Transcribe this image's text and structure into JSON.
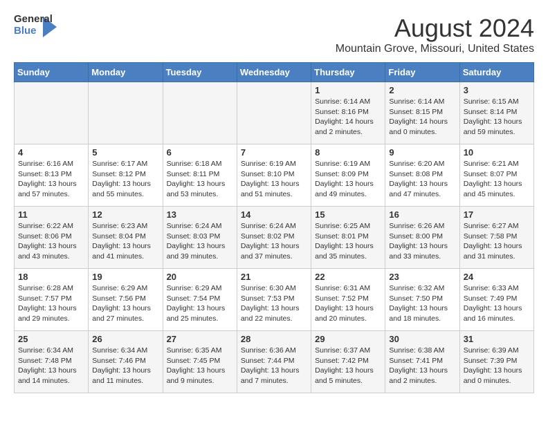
{
  "header": {
    "logo_general": "General",
    "logo_blue": "Blue",
    "main_title": "August 2024",
    "sub_title": "Mountain Grove, Missouri, United States"
  },
  "calendar": {
    "days_of_week": [
      "Sunday",
      "Monday",
      "Tuesday",
      "Wednesday",
      "Thursday",
      "Friday",
      "Saturday"
    ],
    "weeks": [
      [
        {
          "day": "",
          "info": ""
        },
        {
          "day": "",
          "info": ""
        },
        {
          "day": "",
          "info": ""
        },
        {
          "day": "",
          "info": ""
        },
        {
          "day": "1",
          "info": "Sunrise: 6:14 AM\nSunset: 8:16 PM\nDaylight: 14 hours\nand 2 minutes."
        },
        {
          "day": "2",
          "info": "Sunrise: 6:14 AM\nSunset: 8:15 PM\nDaylight: 14 hours\nand 0 minutes."
        },
        {
          "day": "3",
          "info": "Sunrise: 6:15 AM\nSunset: 8:14 PM\nDaylight: 13 hours\nand 59 minutes."
        }
      ],
      [
        {
          "day": "4",
          "info": "Sunrise: 6:16 AM\nSunset: 8:13 PM\nDaylight: 13 hours\nand 57 minutes."
        },
        {
          "day": "5",
          "info": "Sunrise: 6:17 AM\nSunset: 8:12 PM\nDaylight: 13 hours\nand 55 minutes."
        },
        {
          "day": "6",
          "info": "Sunrise: 6:18 AM\nSunset: 8:11 PM\nDaylight: 13 hours\nand 53 minutes."
        },
        {
          "day": "7",
          "info": "Sunrise: 6:19 AM\nSunset: 8:10 PM\nDaylight: 13 hours\nand 51 minutes."
        },
        {
          "day": "8",
          "info": "Sunrise: 6:19 AM\nSunset: 8:09 PM\nDaylight: 13 hours\nand 49 minutes."
        },
        {
          "day": "9",
          "info": "Sunrise: 6:20 AM\nSunset: 8:08 PM\nDaylight: 13 hours\nand 47 minutes."
        },
        {
          "day": "10",
          "info": "Sunrise: 6:21 AM\nSunset: 8:07 PM\nDaylight: 13 hours\nand 45 minutes."
        }
      ],
      [
        {
          "day": "11",
          "info": "Sunrise: 6:22 AM\nSunset: 8:06 PM\nDaylight: 13 hours\nand 43 minutes."
        },
        {
          "day": "12",
          "info": "Sunrise: 6:23 AM\nSunset: 8:04 PM\nDaylight: 13 hours\nand 41 minutes."
        },
        {
          "day": "13",
          "info": "Sunrise: 6:24 AM\nSunset: 8:03 PM\nDaylight: 13 hours\nand 39 minutes."
        },
        {
          "day": "14",
          "info": "Sunrise: 6:24 AM\nSunset: 8:02 PM\nDaylight: 13 hours\nand 37 minutes."
        },
        {
          "day": "15",
          "info": "Sunrise: 6:25 AM\nSunset: 8:01 PM\nDaylight: 13 hours\nand 35 minutes."
        },
        {
          "day": "16",
          "info": "Sunrise: 6:26 AM\nSunset: 8:00 PM\nDaylight: 13 hours\nand 33 minutes."
        },
        {
          "day": "17",
          "info": "Sunrise: 6:27 AM\nSunset: 7:58 PM\nDaylight: 13 hours\nand 31 minutes."
        }
      ],
      [
        {
          "day": "18",
          "info": "Sunrise: 6:28 AM\nSunset: 7:57 PM\nDaylight: 13 hours\nand 29 minutes."
        },
        {
          "day": "19",
          "info": "Sunrise: 6:29 AM\nSunset: 7:56 PM\nDaylight: 13 hours\nand 27 minutes."
        },
        {
          "day": "20",
          "info": "Sunrise: 6:29 AM\nSunset: 7:54 PM\nDaylight: 13 hours\nand 25 minutes."
        },
        {
          "day": "21",
          "info": "Sunrise: 6:30 AM\nSunset: 7:53 PM\nDaylight: 13 hours\nand 22 minutes."
        },
        {
          "day": "22",
          "info": "Sunrise: 6:31 AM\nSunset: 7:52 PM\nDaylight: 13 hours\nand 20 minutes."
        },
        {
          "day": "23",
          "info": "Sunrise: 6:32 AM\nSunset: 7:50 PM\nDaylight: 13 hours\nand 18 minutes."
        },
        {
          "day": "24",
          "info": "Sunrise: 6:33 AM\nSunset: 7:49 PM\nDaylight: 13 hours\nand 16 minutes."
        }
      ],
      [
        {
          "day": "25",
          "info": "Sunrise: 6:34 AM\nSunset: 7:48 PM\nDaylight: 13 hours\nand 14 minutes."
        },
        {
          "day": "26",
          "info": "Sunrise: 6:34 AM\nSunset: 7:46 PM\nDaylight: 13 hours\nand 11 minutes."
        },
        {
          "day": "27",
          "info": "Sunrise: 6:35 AM\nSunset: 7:45 PM\nDaylight: 13 hours\nand 9 minutes."
        },
        {
          "day": "28",
          "info": "Sunrise: 6:36 AM\nSunset: 7:44 PM\nDaylight: 13 hours\nand 7 minutes."
        },
        {
          "day": "29",
          "info": "Sunrise: 6:37 AM\nSunset: 7:42 PM\nDaylight: 13 hours\nand 5 minutes."
        },
        {
          "day": "30",
          "info": "Sunrise: 6:38 AM\nSunset: 7:41 PM\nDaylight: 13 hours\nand 2 minutes."
        },
        {
          "day": "31",
          "info": "Sunrise: 6:39 AM\nSunset: 7:39 PM\nDaylight: 13 hours\nand 0 minutes."
        }
      ]
    ]
  }
}
